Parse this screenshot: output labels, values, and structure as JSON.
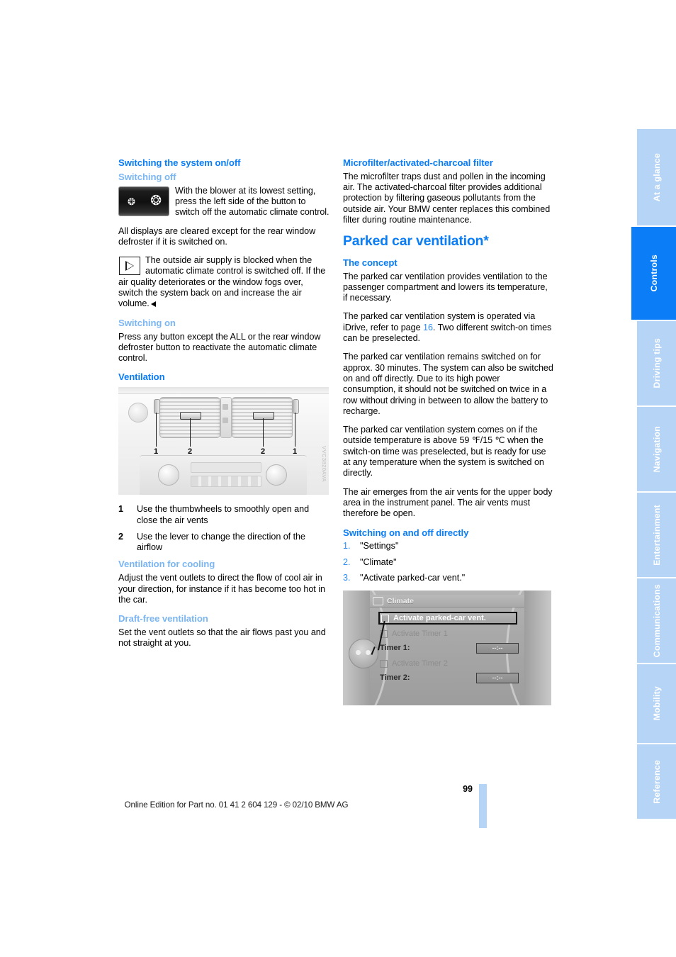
{
  "page": {
    "number": "99",
    "footer_text": "Online Edition for Part no. 01 41 2 604 129 - © 02/10 BMW AG"
  },
  "sidebar": {
    "tabs": [
      {
        "label": "At a glance",
        "active": false
      },
      {
        "label": "Controls",
        "active": true
      },
      {
        "label": "Driving tips",
        "active": false
      },
      {
        "label": "Navigation",
        "active": false
      },
      {
        "label": "Entertainment",
        "active": false
      },
      {
        "label": "Communications",
        "active": false
      },
      {
        "label": "Mobility",
        "active": false
      },
      {
        "label": "Reference",
        "active": false
      }
    ]
  },
  "left_column": {
    "heading_switching_system": "Switching the system on/off",
    "subhead_switching_off": "Switching off",
    "blower_note": "With the blower at its lowest setting, press the left side of the button to switch off the automatic climate control.",
    "displays_cleared": "All displays are cleared except for the rear window defroster if it is switched on.",
    "outside_air_note": "The outside air supply is blocked when the automatic climate control is switched off. If the air quality deteriorates or the window fogs over, switch the system back on and increase the air volume.",
    "subhead_switching_on": "Switching on",
    "switching_on_text": "Press any button except the ALL or the rear window defroster button to reactivate the automatic climate control.",
    "heading_ventilation": "Ventilation",
    "figure_code": "VVC3820AVA",
    "callouts": [
      {
        "num": "1",
        "text": "Use the thumbwheels to smoothly open and close the air vents"
      },
      {
        "num": "2",
        "text": "Use the lever to change the direction of the airflow"
      }
    ],
    "subhead_cooling": "Ventilation for cooling",
    "cooling_text": "Adjust the vent outlets to direct the flow of cool air in your direction, for instance if it has become too hot in the car.",
    "subhead_draft_free": "Draft-free ventilation",
    "draft_free_text": "Set the vent outlets so that the air flows past you and not straight at you."
  },
  "right_column": {
    "heading_microfilter": "Microfilter/activated-charcoal filter",
    "microfilter_text": "The microfilter traps dust and pollen in the incoming air. The activated-charcoal filter provides additional protection by filtering gaseous pollutants from the outside air. Your BMW center replaces this combined filter during routine maintenance.",
    "section_title": "Parked car ventilation*",
    "subhead_concept": "The concept",
    "concept_p1": "The parked car ventilation provides ventilation to the passenger compartment and lowers its temperature, if necessary.",
    "concept_p2_before": "The parked car ventilation system is operated via iDrive, refer to page ",
    "concept_p2_ref": "16",
    "concept_p2_after": ". Two different switch-on times can be preselected.",
    "concept_p3": "The parked car ventilation remains switched on for approx. 30 minutes. The system can also be switched on and off directly. Due to its high power consumption, it should not be switched on twice in a row without driving in between to allow the battery to recharge.",
    "concept_p4": "The parked car ventilation system comes on if the outside temperature is above 59 ℉/15 ℃ when the switch-on time was preselected, but is ready for use at any temperature when the system is switched on directly.",
    "concept_p5": "The air emerges from the air vents for the upper body area in the instrument panel. The air vents must therefore be open.",
    "subhead_switching_direct": "Switching on and off directly",
    "steps": [
      {
        "num": "1.",
        "text": "\"Settings\""
      },
      {
        "num": "2.",
        "text": "\"Climate\""
      },
      {
        "num": "3.",
        "text": "\"Activate parked-car vent.\""
      }
    ],
    "idrive": {
      "header": "Climate",
      "rows": [
        {
          "label": "Activate parked-car vent.",
          "state": "selected",
          "field": ""
        },
        {
          "label": "Activate Timer 1",
          "state": "dim",
          "field": ""
        },
        {
          "label": "Timer 1:",
          "state": "strong",
          "field": "--:--"
        },
        {
          "label": "Activate Timer 2",
          "state": "dim",
          "field": ""
        },
        {
          "label": "Timer 2:",
          "state": "strong",
          "field": "--:--"
        }
      ]
    }
  },
  "colors": {
    "heading_blue": "#0a7cf4",
    "subheading_light_blue": "#7cb6f2",
    "tab_inactive": "#b6d4f5",
    "tab_active": "#0b7ef7",
    "xref_blue": "#2f8df5"
  }
}
